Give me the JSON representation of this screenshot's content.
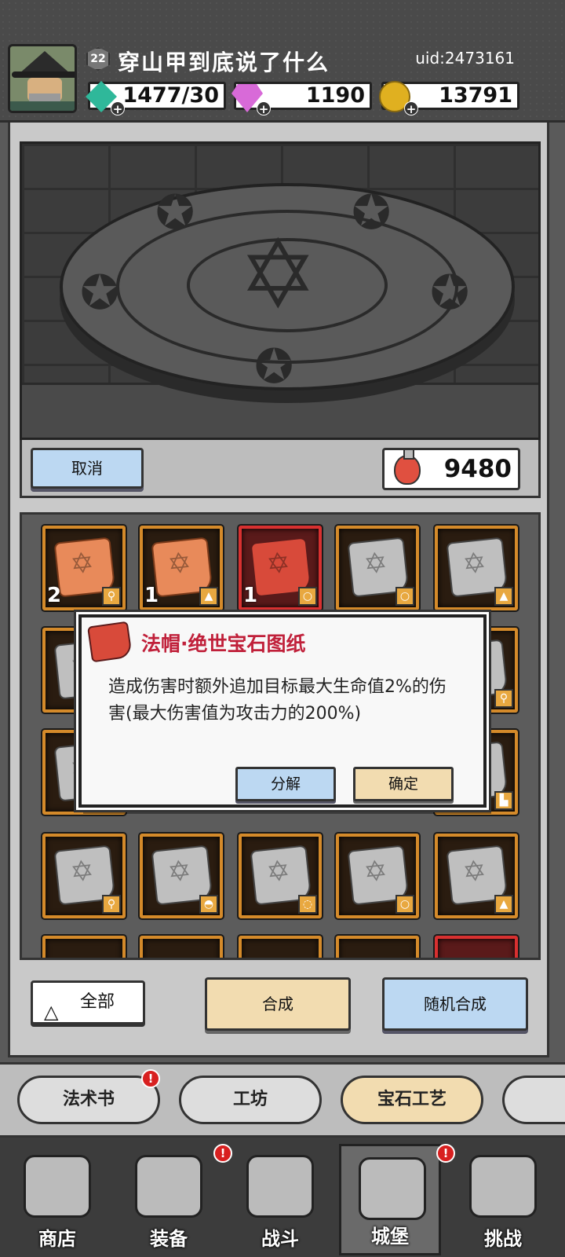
{
  "player": {
    "level": "22",
    "name": "穿山甲到底说了什么",
    "uid": "uid:2473161"
  },
  "resources": [
    {
      "icon": "energy-gem-icon",
      "value": "1477/30",
      "color": "#2fb89a"
    },
    {
      "icon": "diamond-icon",
      "value": "1190",
      "color": "#d86ad8"
    },
    {
      "icon": "gold-coin-icon",
      "value": "13791",
      "color": "#e0b020"
    }
  ],
  "scene": {
    "cancel_label": "取消",
    "potion_count": "9480"
  },
  "grid": {
    "row1": [
      {
        "count": "2",
        "slot": "staff"
      },
      {
        "count": "1",
        "slot": "robe"
      },
      {
        "count": "1",
        "slot": "ring"
      },
      {
        "count": "",
        "slot": "ring"
      },
      {
        "count": "",
        "slot": "robe"
      }
    ]
  },
  "dialog": {
    "title": "法帽·绝世宝石图纸",
    "description": "造成伤害时额外追加目标最大生命值2%的伤害(最大伤害值为攻击力的200%)",
    "decompose_label": "分解",
    "confirm_label": "确定"
  },
  "actions": {
    "all_label": "全部",
    "synthesize_label": "合成",
    "random_synthesize_label": "随机合成"
  },
  "subtabs": [
    {
      "label": "法术书",
      "notify": "!"
    },
    {
      "label": "工坊"
    },
    {
      "label": "宝石工艺",
      "active": true
    }
  ],
  "bottom_nav": [
    {
      "label": "商店"
    },
    {
      "label": "装备",
      "notify": "!"
    },
    {
      "label": "战斗"
    },
    {
      "label": "城堡",
      "notify": "!",
      "active": true
    },
    {
      "label": "挑战"
    }
  ],
  "colors": {
    "accent_red": "#c0203a",
    "button_blue": "#bcd8f2",
    "button_beige": "#f2dcb0",
    "cell_border": "#d48a2a"
  }
}
